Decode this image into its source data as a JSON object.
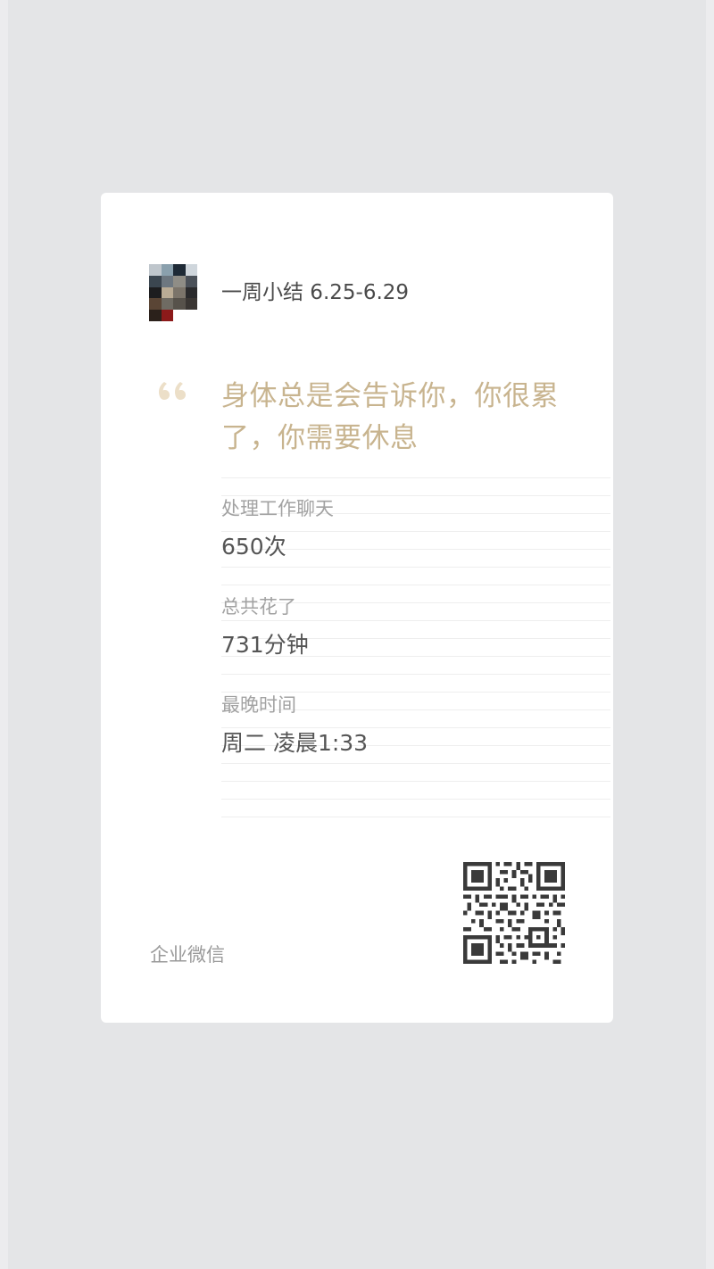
{
  "card": {
    "title": "一周小结 6.25-6.29",
    "quote": "身体总是会告诉你，你很累了，你需要休息",
    "stats": [
      {
        "label": "处理工作聊天",
        "value": "650次"
      },
      {
        "label": "总共花了",
        "value": "731分钟"
      },
      {
        "label": "最晚时间",
        "value": "周二 凌晨1:33"
      }
    ],
    "brand": "企业微信"
  },
  "colors": {
    "background": "#e4e5e7",
    "card": "#ffffff",
    "quote": "#c8b48f",
    "quote_mark": "#ecdfc8",
    "label": "#a2a2a2",
    "value": "#555555"
  },
  "icons": {
    "avatar": "pixelated-avatar",
    "quote": "open-quote-icon",
    "qr": "qr-code-icon"
  }
}
